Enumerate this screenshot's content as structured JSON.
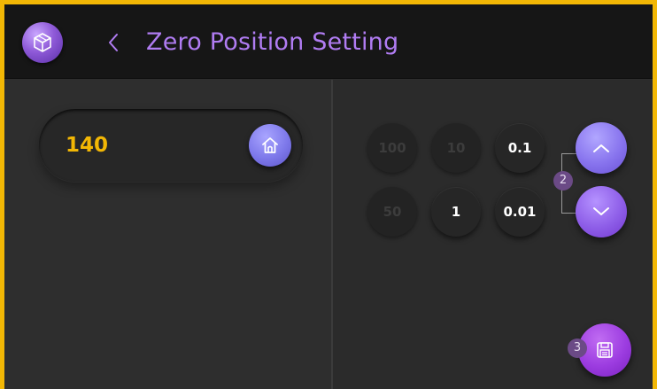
{
  "header": {
    "title": "Zero Position Setting",
    "logo_icon": "cube-icon",
    "back_icon": "chevron-left-icon"
  },
  "position": {
    "value": "140",
    "home_icon": "home-icon"
  },
  "steps": {
    "s100": "100",
    "s10": "10",
    "s01": "0.1",
    "s50": "50",
    "s1": "1",
    "s001": "0.01"
  },
  "controls": {
    "up_icon": "chevron-up-icon",
    "down_icon": "chevron-down-icon",
    "arrows_badge": "2",
    "save_badge": "3",
    "save_icon": "save-icon"
  },
  "colors": {
    "accent_purple": "#b07cf2",
    "value_yellow": "#f2b705",
    "frame_yellow": "#f2b705"
  }
}
